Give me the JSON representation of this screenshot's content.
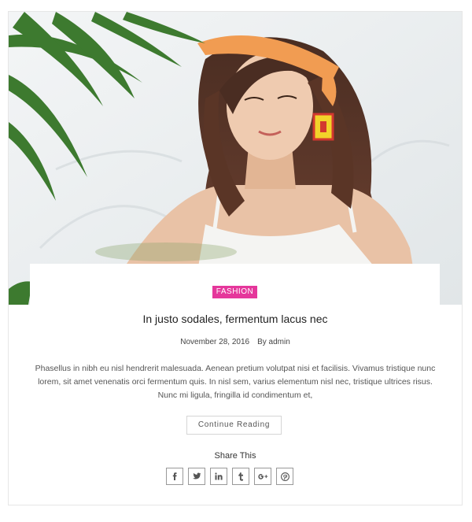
{
  "post": {
    "category": "FASHION",
    "title": "In justo sodales, fermentum lacus nec",
    "date": "November 28, 2016",
    "author": "By admin",
    "excerpt": "Phasellus in nibh eu nisl hendrerit malesuada. Aenean pretium volutpat nisi et facilisis. Vivamus tristique nunc lorem, sit amet venenatis orci fermentum quis. In nisl sem, varius elementum nisl nec, tristique ultrices risus. Nunc mi ligula, fringilla id condimentum et,",
    "read_more": "Continue Reading"
  },
  "share": {
    "title": "Share This",
    "buttons": [
      {
        "icon": "facebook-icon"
      },
      {
        "icon": "twitter-icon"
      },
      {
        "icon": "linkedin-icon"
      },
      {
        "icon": "tumblr-icon"
      },
      {
        "icon": "google-plus-icon"
      },
      {
        "icon": "pinterest-icon"
      }
    ]
  },
  "colors": {
    "accent": "#e5379b",
    "border": "#e6e6e6"
  }
}
